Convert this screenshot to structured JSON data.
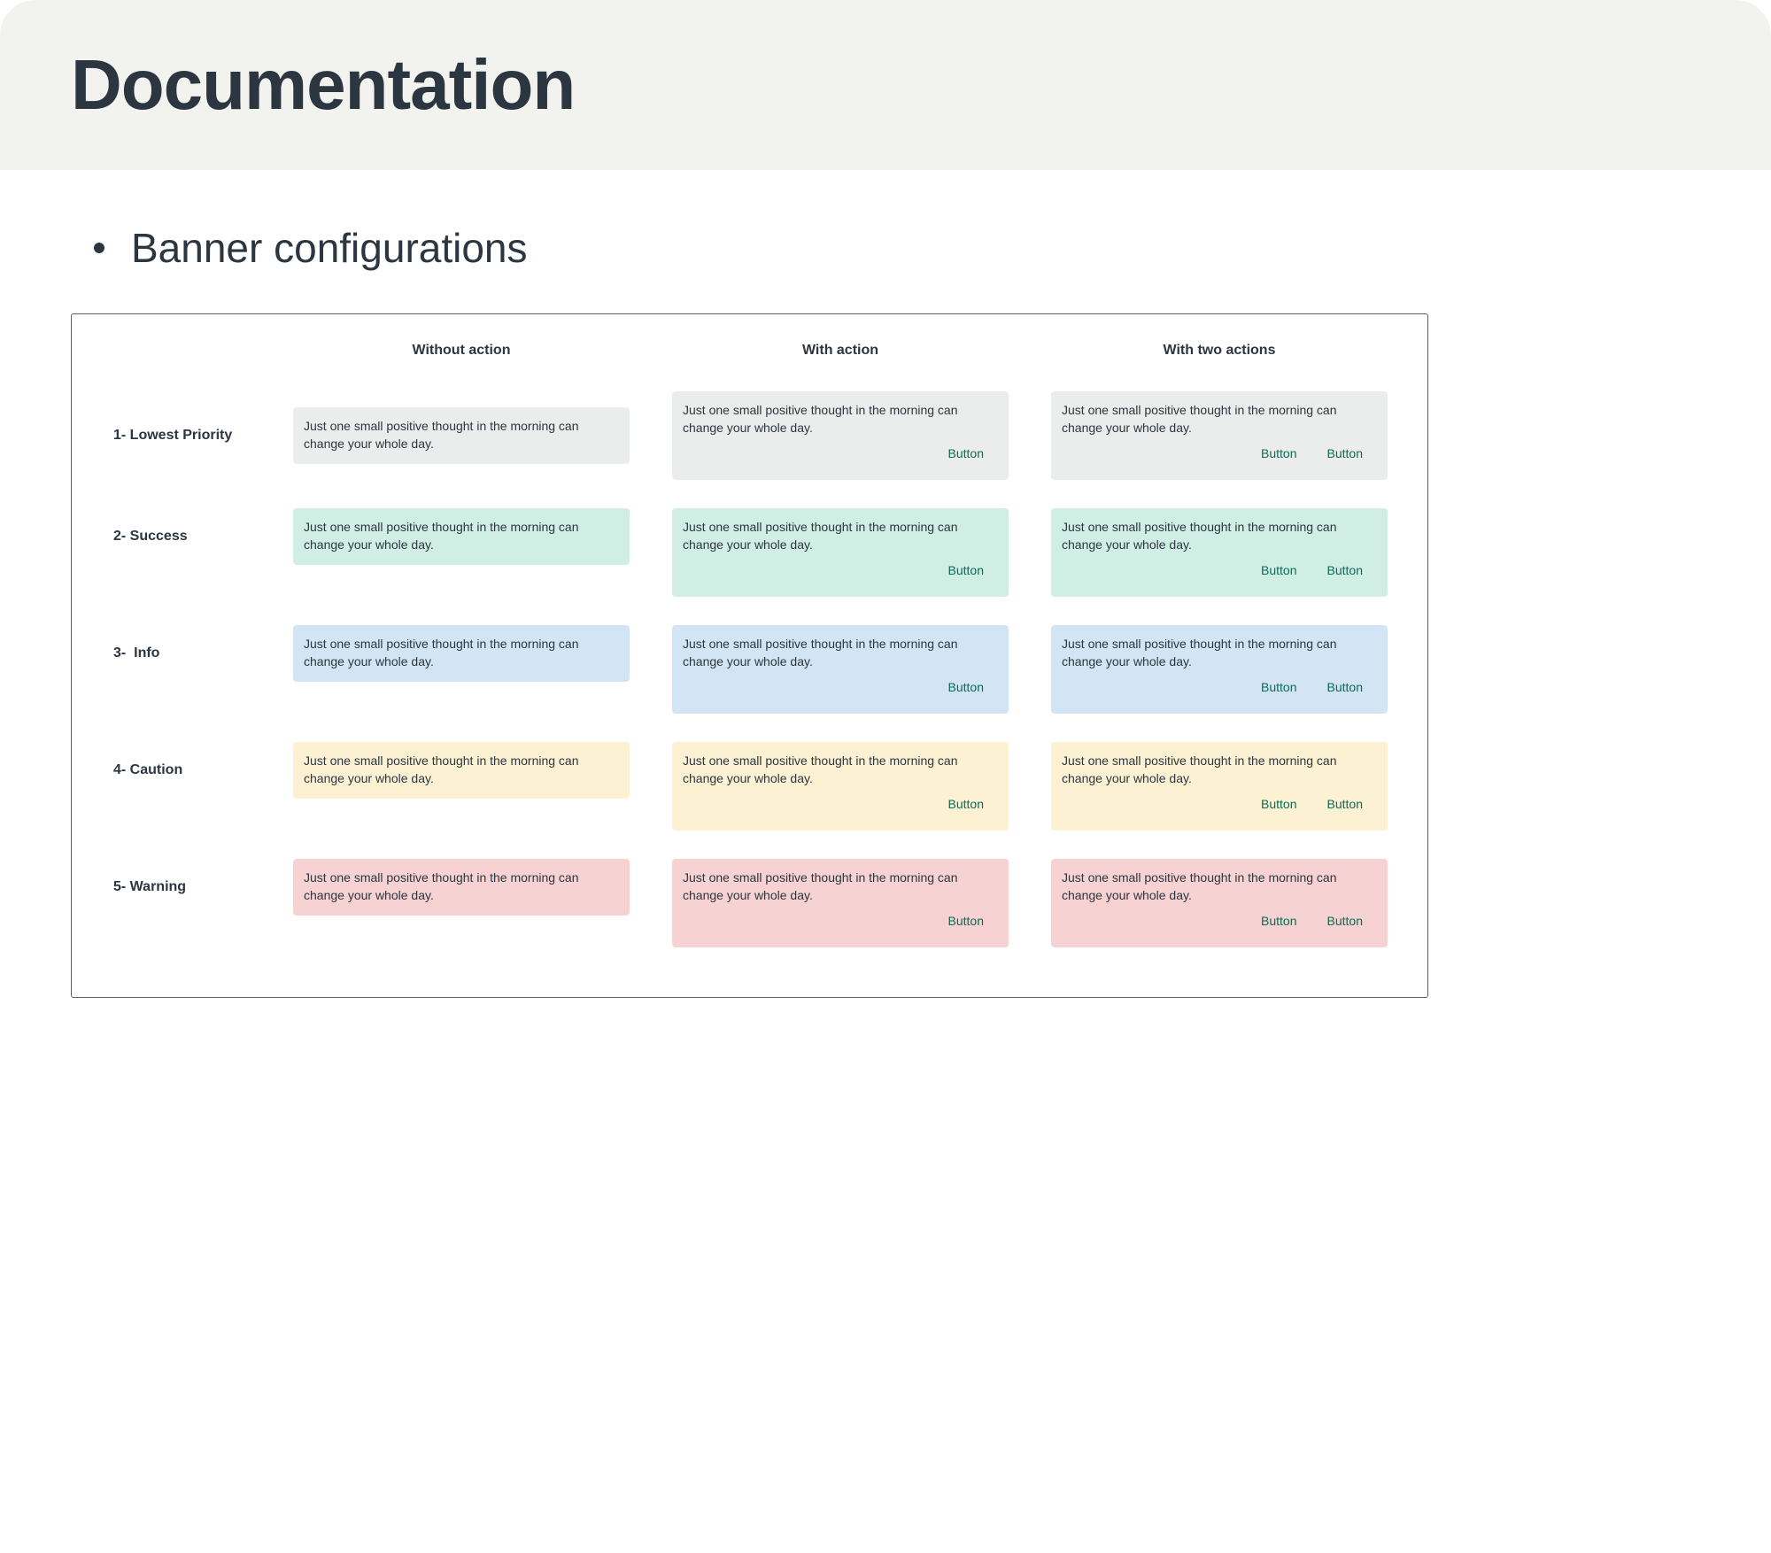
{
  "header": {
    "title": "Documentation"
  },
  "section": {
    "heading": "Banner configurations"
  },
  "table": {
    "columns": [
      "Without action",
      "With action",
      "With two actions"
    ],
    "rows": [
      {
        "label": "1- Lowest Priority",
        "tone": "lowest",
        "color": "#ebecec",
        "text": "Just one small positive thought in the morning can change your whole day.",
        "button_label": "Button"
      },
      {
        "label": "2- Success",
        "tone": "success",
        "color": "#d1eee5",
        "text": "Just one small positive thought in the morning can change your whole day.",
        "button_label": "Button"
      },
      {
        "label": "3-  Info",
        "tone": "info",
        "color": "#d3e5f4",
        "text": "Just one small positive thought in the morning can change your whole day.",
        "button_label": "Button"
      },
      {
        "label": "4- Caution",
        "tone": "caution",
        "color": "#fcf2d3",
        "text": "Just one small positive thought in the morning can change your whole day.",
        "button_label": "Button"
      },
      {
        "label": "5- Warning",
        "tone": "warning",
        "color": "#f6d2d2",
        "text": "Just one small positive thought in the morning can change your whole day.",
        "button_label": "Button"
      }
    ]
  },
  "colors": {
    "text": "#2c3640",
    "button_text": "#0b6b55",
    "header_background": "#f2f3ee",
    "frame_border": "#5a5f63"
  }
}
